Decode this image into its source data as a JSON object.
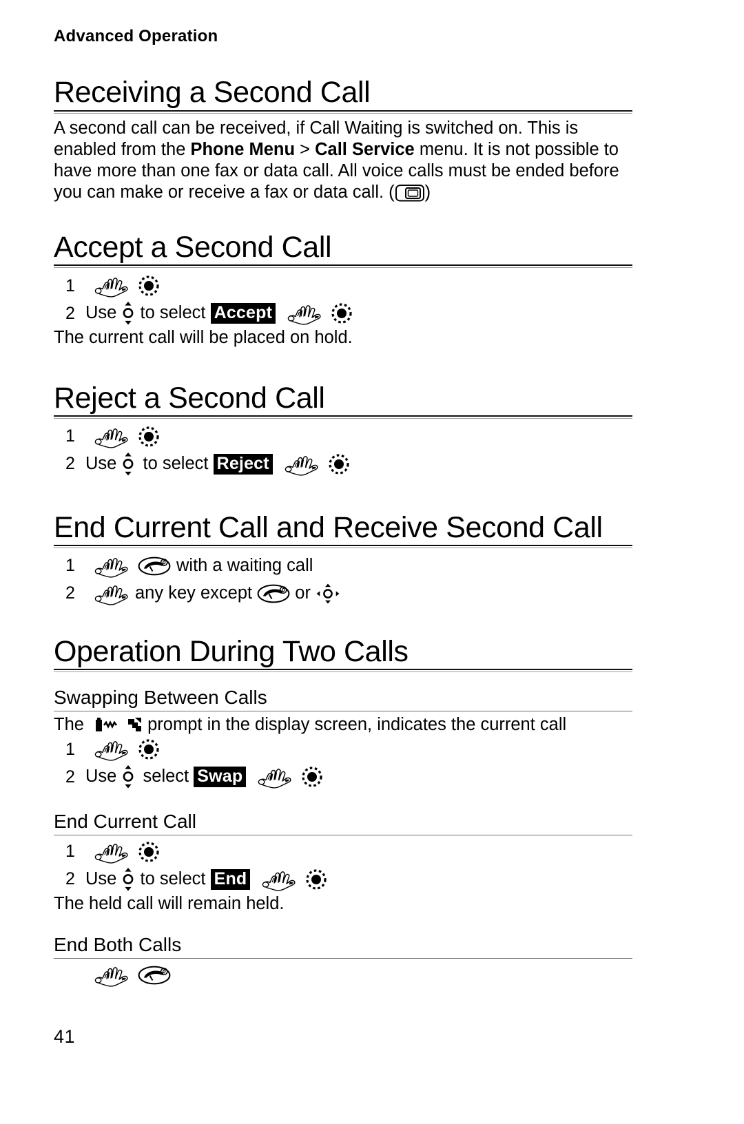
{
  "document": {
    "running_header": "Advanced Operation",
    "page_number": "41"
  },
  "sections": [
    {
      "id": "receiving-second-call",
      "heading": "Receiving a Second Call",
      "paragraph_part1": "A second call can be received, if Call Waiting is switched on. This is enabled from the ",
      "paragraph_bold1": "Phone Menu",
      "paragraph_part2": " > ",
      "paragraph_bold2": "Call Service",
      "paragraph_part3": " menu. It is not possible to have more than one fax or data call. All voice calls must be ended before you can make or receive a fax or data call. (",
      "paragraph_part4": ")"
    },
    {
      "id": "accept-second-call",
      "heading": "Accept a Second Call",
      "steps": [
        {
          "number": "1",
          "text_before": "",
          "text_after": ""
        },
        {
          "number": "2",
          "text_before": "Use ",
          "text_mid": " to select ",
          "menu_label": "Accept",
          "text_after": ""
        }
      ],
      "note": "The current call will be placed on hold."
    },
    {
      "id": "reject-second-call",
      "heading": "Reject a Second Call",
      "steps": [
        {
          "number": "1",
          "text_before": "",
          "text_after": ""
        },
        {
          "number": "2",
          "text_before": "Use ",
          "text_mid": " to select ",
          "menu_label": "Reject",
          "text_after": ""
        }
      ]
    },
    {
      "id": "end-current-receive-second",
      "heading": "End Current Call and Receive Second Call",
      "steps": [
        {
          "number": "1",
          "text_after": "with a waiting call"
        },
        {
          "number": "2",
          "text_before": "any key except ",
          "text_mid": " or "
        }
      ]
    },
    {
      "id": "operation-during-two-calls",
      "heading": "Operation During Two Calls",
      "subsections": [
        {
          "id": "swapping-between-calls",
          "heading": "Swapping Between Calls",
          "intro_before": "The ",
          "intro_after": " prompt in the display screen, indicates the current call",
          "steps": [
            {
              "number": "1"
            },
            {
              "number": "2",
              "text_before": "Use ",
              "text_mid": " select ",
              "menu_label": "Swap"
            }
          ]
        },
        {
          "id": "end-current-call",
          "heading": "End Current Call",
          "steps": [
            {
              "number": "1"
            },
            {
              "number": "2",
              "text_before": "Use ",
              "text_mid": " to select ",
              "menu_label": "End"
            }
          ],
          "note": "The held call will remain held."
        },
        {
          "id": "end-both-calls",
          "heading": "End Both Calls",
          "steps": [
            {
              "number": ""
            }
          ]
        }
      ]
    }
  ],
  "icons": {
    "hand": "press-key-hand-icon",
    "soft_key": "soft-key-select-icon",
    "scroll_key": "up-down-scroll-key-icon",
    "nav_key_4way": "four-way-navigation-key-icon",
    "end_call_key": "end-call-key-icon",
    "sim_card": "sim-card-icon",
    "display_phone": "display-phone-wave-icon",
    "display_handset": "display-handset-arrow-icon"
  },
  "colors": {
    "text": "#000000",
    "background": "#ffffff",
    "rule_dark": "#111111",
    "rule_light": "#9a9a9a",
    "inverse_bg": "#000000",
    "inverse_fg": "#ffffff"
  }
}
